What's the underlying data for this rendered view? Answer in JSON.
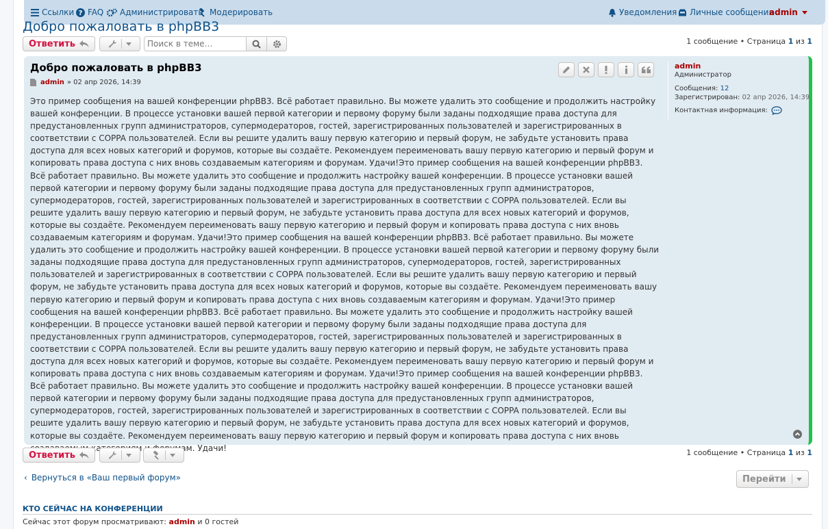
{
  "nav": {
    "links": "Ссылки",
    "faq": "FAQ",
    "admin": "Администрировать",
    "moderate": "Модерировать",
    "notifications": "Уведомления",
    "messages": "Личные сообщения",
    "user": "admin"
  },
  "topic": {
    "title": "Добро пожаловать в phpBB3",
    "reply_label": "Ответить",
    "search_placeholder": "Поиск в теме…"
  },
  "pagination": {
    "count": "1 сообщение",
    "bullet": "•",
    "page_word": "Страница",
    "current": "1",
    "of_word": "из",
    "total": "1"
  },
  "post": {
    "title": "Добро пожаловать в phpBB3",
    "author": "admin",
    "date": "» 02 апр 2026, 14:39",
    "content": "Это пример сообщения на вашей конференции phpBB3. Всё работает правильно. Вы можете удалить это сообщение и продолжить настройку вашей конференции. В процессе установки вашей первой категории и первому форуму были заданы подходящие права доступа для предустановленных групп администраторов, супермодераторов, гостей, зарегистрированных пользователей и зарегистрированных в соответствии с COPPA пользователей. Если вы решите удалить вашу первую категорию и первый форум, не забудьте установить права доступа для всех новых категорий и форумов, которые вы создаёте. Рекомендуем переименовать вашу первую категорию и первый форум и копировать права доступа с них вновь создаваемым категориям и форумам. Удачи!Это пример сообщения на вашей конференции phpBB3. Всё работает правильно. Вы можете удалить это сообщение и продолжить настройку вашей конференции. В процессе установки вашей первой категории и первому форуму были заданы подходящие права доступа для предустановленных групп администраторов, супермодераторов, гостей, зарегистрированных пользователей и зарегистрированных в соответствии с COPPA пользователей. Если вы решите удалить вашу первую категорию и первый форум, не забудьте установить права доступа для всех новых категорий и форумов, которые вы создаёте. Рекомендуем переименовать вашу первую категорию и первый форум и копировать права доступа с них вновь создаваемым категориям и форумам. Удачи!Это пример сообщения на вашей конференции phpBB3. Всё работает правильно. Вы можете удалить это сообщение и продолжить настройку вашей конференции. В процессе установки вашей первой категории и первому форуму были заданы подходящие права доступа для предустановленных групп администраторов, супермодераторов, гостей, зарегистрированных пользователей и зарегистрированных в соответствии с COPPA пользователей. Если вы решите удалить вашу первую категорию и первый форум, не забудьте установить права доступа для всех новых категорий и форумов, которые вы создаёте. Рекомендуем переименовать вашу первую категорию и первый форум и копировать права доступа с них вновь создаваемым категориям и форумам. Удачи!Это пример сообщения на вашей конференции phpBB3. Всё работает правильно. Вы можете удалить это сообщение и продолжить настройку вашей конференции. В процессе установки вашей первой категории и первому форуму были заданы подходящие права доступа для предустановленных групп администраторов, супермодераторов, гостей, зарегистрированных пользователей и зарегистрированных в соответствии с COPPA пользователей. Если вы решите удалить вашу первую категорию и первый форум, не забудьте установить права доступа для всех новых категорий и форумов, которые вы создаёте. Рекомендуем переименовать вашу первую категорию и первый форум и копировать права доступа с них вновь создаваемым категориям и форумам. Удачи!Это пример сообщения на вашей конференции phpBB3. Всё работает правильно. Вы можете удалить это сообщение и продолжить настройку вашей конференции. В процессе установки вашей первой категории и первому форуму были заданы подходящие права доступа для предустановленных групп администраторов, супермодераторов, гостей, зарегистрированных пользователей и зарегистрированных в соответствии с COPPA пользователей. Если вы решите удалить вашу первую категорию и первый форум, не забудьте установить права доступа для всех новых категорий и форумов, которые вы создаёте. Рекомендуем переименовать вашу первую категорию и первый форум и копировать права доступа с них вновь создаваемым категориям и форумам. Удачи!"
  },
  "profile": {
    "name": "admin",
    "rank": "Администратор",
    "posts_label": "Сообщения:",
    "posts_value": "12",
    "registered_label": "Зарегистрирован:",
    "registered_value": "02 апр 2026, 14:39",
    "contact_label": "Контактная информация:"
  },
  "footer": {
    "back_link": "Вернуться в «Ваш первый форум»",
    "goto_label": "Перейти",
    "online_heading": "КТО СЕЙЧАС НА КОНФЕРЕНЦИИ",
    "online_prefix": "Сейчас этот форум просматривают:",
    "online_user": "admin",
    "online_suffix": "и 0 гостей"
  },
  "colors": {
    "link": "#105289",
    "accent_red": "#d31141",
    "user_red": "#aa0000",
    "post_bg": "#e1ebf2",
    "online_bar": "#21c24b"
  }
}
